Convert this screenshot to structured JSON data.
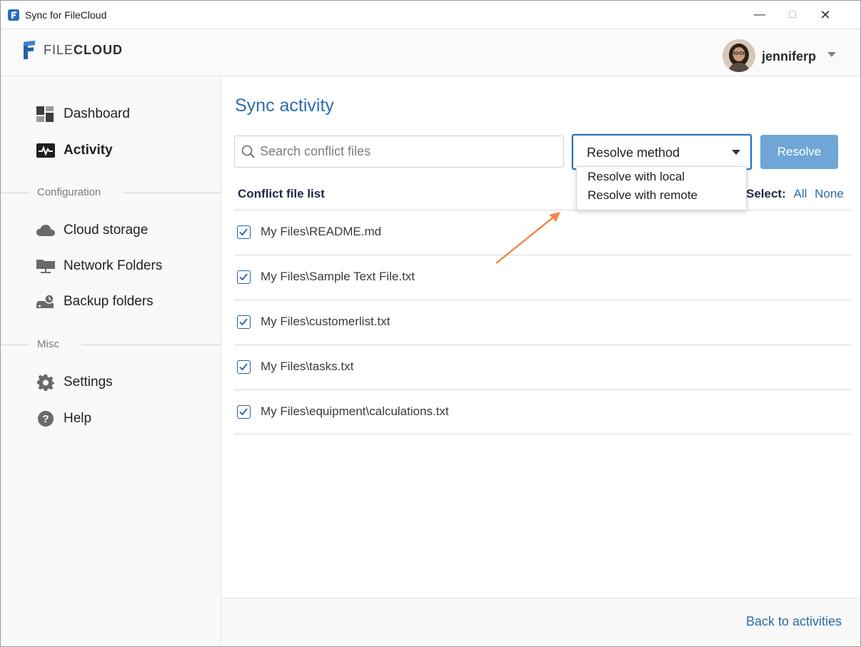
{
  "window": {
    "title": "Sync for FileCloud",
    "minimize_glyph": "—",
    "maximize_glyph": "☐",
    "close_glyph": "✕"
  },
  "header": {
    "logo_text_light": "FILE",
    "logo_text_bold": "CLOUD",
    "username": "jenniferp"
  },
  "sidebar": {
    "items": [
      {
        "label": "Dashboard",
        "icon": "dashboard-icon"
      },
      {
        "label": "Activity",
        "icon": "activity-icon",
        "active": true
      }
    ],
    "configuration_label": "Configuration",
    "config_items": [
      {
        "label": "Cloud storage",
        "icon": "cloud-icon"
      },
      {
        "label": "Network Folders",
        "icon": "network-folder-icon"
      },
      {
        "label": "Backup folders",
        "icon": "backup-icon"
      }
    ],
    "misc_label": "Misc",
    "misc_items": [
      {
        "label": "Settings",
        "icon": "gear-icon"
      },
      {
        "label": "Help",
        "icon": "help-icon"
      }
    ]
  },
  "main": {
    "title": "Sync activity",
    "search_placeholder": "Search conflict files",
    "resolve_method": {
      "selected": "Resolve method",
      "options": [
        "Resolve with local",
        "Resolve with remote"
      ]
    },
    "resolve_button": "Resolve",
    "list_header": "Conflict file list",
    "select_label": "Select:",
    "select_all": "All",
    "select_none": "None",
    "files": [
      {
        "path": "My Files\\README.md",
        "checked": true
      },
      {
        "path": "My Files\\Sample Text File.txt",
        "checked": true
      },
      {
        "path": "My Files\\customerlist.txt",
        "checked": true
      },
      {
        "path": "My Files\\tasks.txt",
        "checked": true
      },
      {
        "path": "My Files\\equipment\\calculations.txt",
        "checked": true
      }
    ]
  },
  "footer": {
    "back_link": "Back to activities"
  },
  "colors": {
    "accent": "#2b6ca8",
    "button": "#6fa6d5",
    "annotation_arrow": "#f08a4b"
  }
}
